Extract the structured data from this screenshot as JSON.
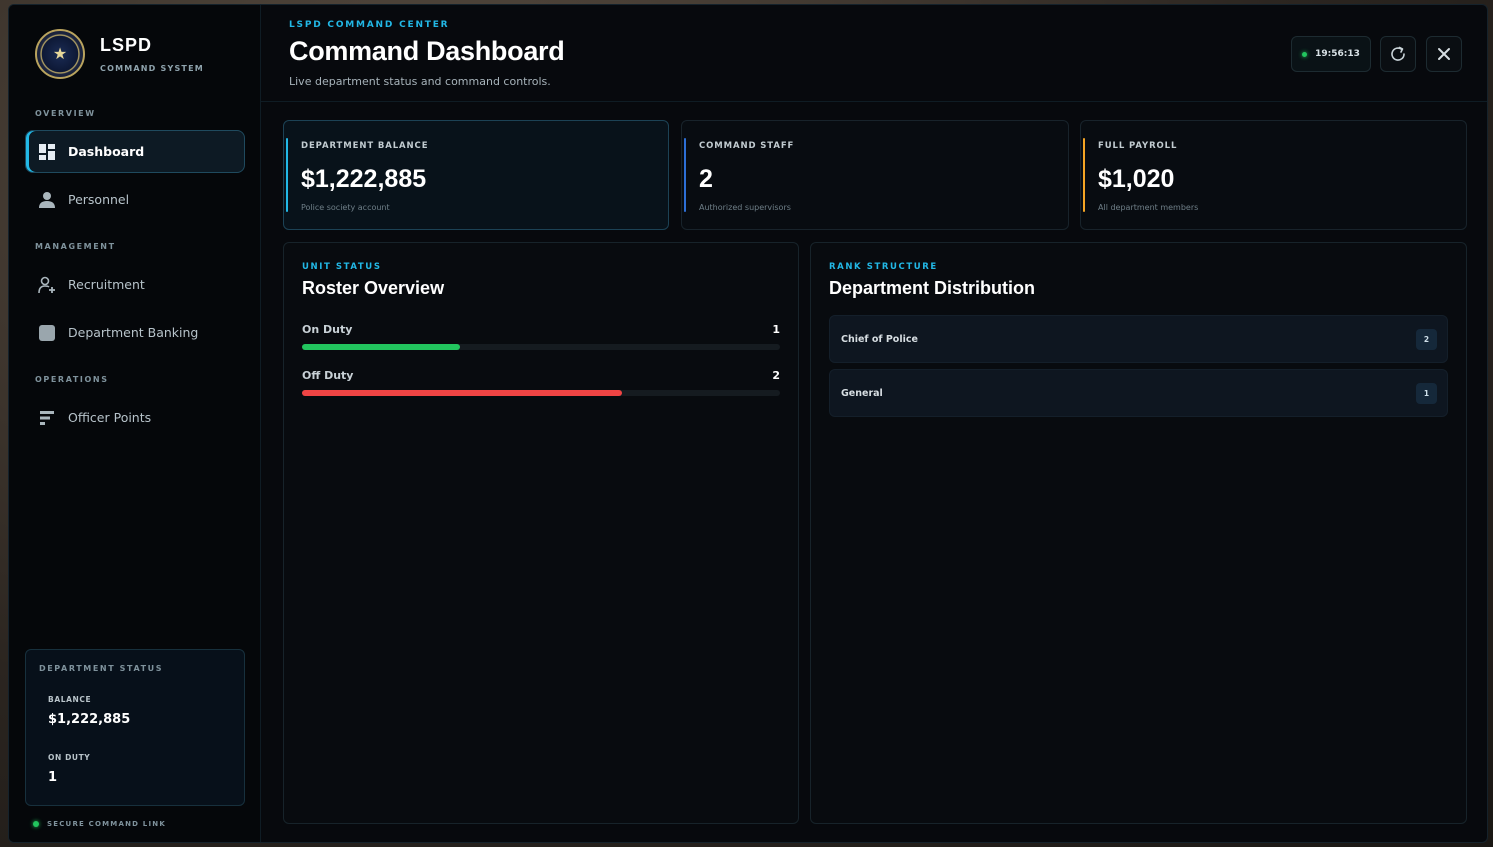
{
  "brand": {
    "title": "LSPD",
    "subtitle": "COMMAND SYSTEM"
  },
  "nav": {
    "sections": [
      {
        "label": "OVERVIEW"
      },
      {
        "label": "MANAGEMENT"
      },
      {
        "label": "OPERATIONS"
      }
    ],
    "items": [
      {
        "label": "Dashboard",
        "icon": "dashboard-icon",
        "active": true
      },
      {
        "label": "Personnel",
        "icon": "user-icon"
      },
      {
        "label": "Recruitment",
        "icon": "add-user-icon"
      },
      {
        "label": "Department Banking",
        "icon": "bank-icon"
      },
      {
        "label": "Officer Points",
        "icon": "bars-icon"
      }
    ]
  },
  "sidebar_status": {
    "title": "DEPARTMENT STATUS",
    "balance_label": "BALANCE",
    "balance_value": "$1,222,885",
    "on_duty_label": "ON DUTY",
    "on_duty_value": "1",
    "secure_link": "SECURE COMMAND LINK"
  },
  "header": {
    "eyebrow": "LSPD COMMAND CENTER",
    "title": "Command Dashboard",
    "subtitle": "Live department status and command controls.",
    "clock": "19:56:13"
  },
  "stats": [
    {
      "label": "DEPARTMENT BALANCE",
      "value": "$1,222,885",
      "note": "Police society account",
      "accent": "#22b8e6"
    },
    {
      "label": "COMMAND STAFF",
      "value": "2",
      "note": "Authorized supervisors",
      "accent": "#2d6fd6"
    },
    {
      "label": "FULL PAYROLL",
      "value": "$1,020",
      "note": "All department members",
      "accent": "#f5a524"
    }
  ],
  "roster": {
    "eyebrow": "UNIT STATUS",
    "title": "Roster Overview",
    "rows": [
      {
        "label": "On Duty",
        "count": "1",
        "fraction": 0.33,
        "color": "#22c55e"
      },
      {
        "label": "Off Duty",
        "count": "2",
        "fraction": 0.67,
        "color": "#ef4444"
      }
    ]
  },
  "ranks": {
    "eyebrow": "RANK STRUCTURE",
    "title": "Department Distribution",
    "rows": [
      {
        "name": "Chief of Police",
        "count": "2"
      },
      {
        "name": "General",
        "count": "1"
      }
    ]
  },
  "colors": {
    "accent": "#22b8e6",
    "online": "#22c55e"
  }
}
